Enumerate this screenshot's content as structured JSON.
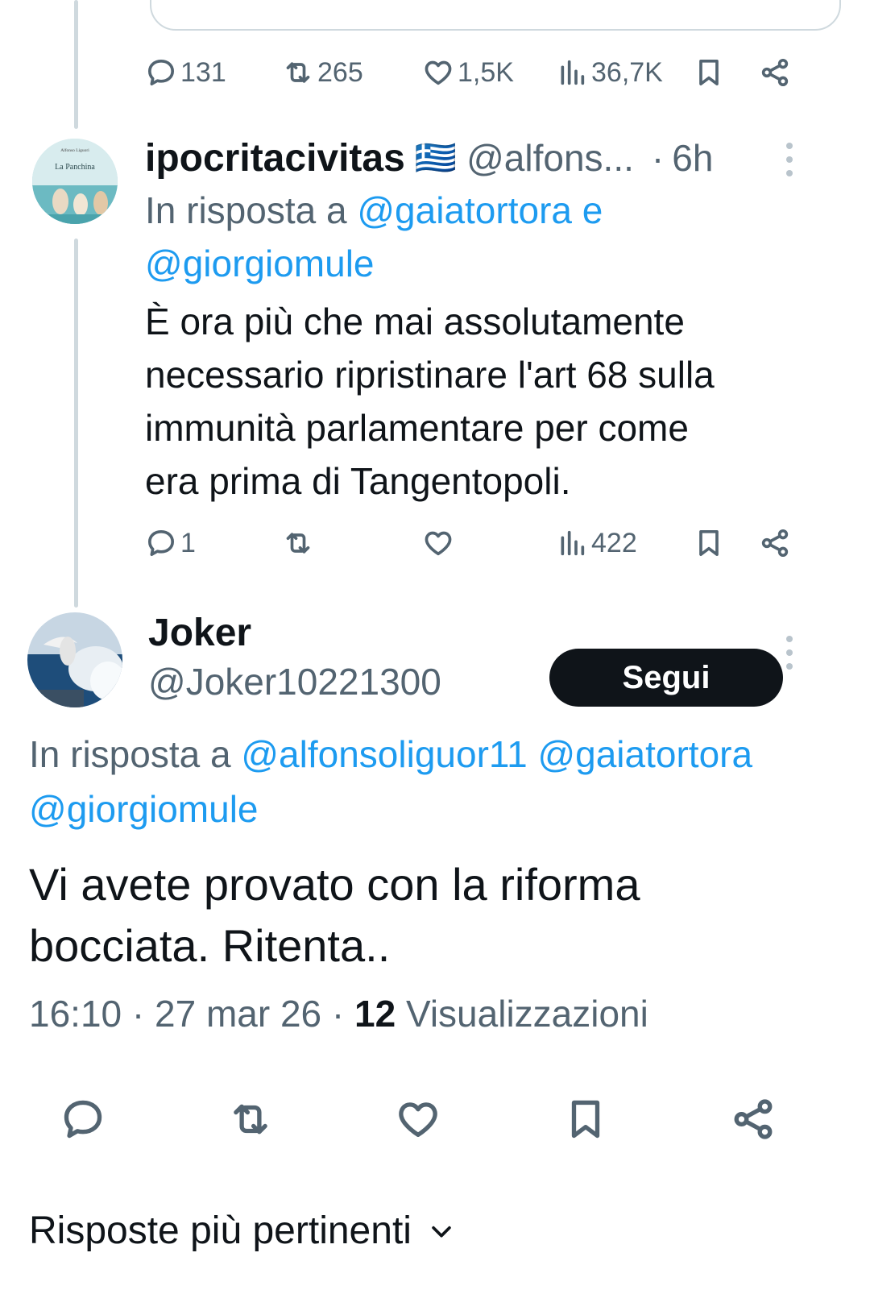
{
  "quoted_tweet_actions": {
    "replies": "131",
    "retweets": "265",
    "likes": "1,5K",
    "views": "36,7K"
  },
  "reply1": {
    "display_name": "ipocritacivitas",
    "flag": "🇬🇷",
    "handle": "@alfons...",
    "separator": "·",
    "time": "6h",
    "reply_prefix": "In risposta a",
    "reply_user1": "@gaiatortora",
    "reply_conj": "e",
    "reply_user2": "@giorgiomule",
    "text_lines": [
      "È ora più che mai assolutamente",
      "necessario ripristinare l'art 68 sulla",
      "immunità parlamentare per come",
      "era prima di Tangentopoli."
    ],
    "avatar_text": {
      "author": "Alfonso Liguori",
      "title": "La Panchina"
    },
    "actions": {
      "replies": "1",
      "retweets": "",
      "likes": "",
      "views": "422"
    }
  },
  "main_tweet": {
    "display_name": "Joker",
    "handle": "@Joker10221300",
    "follow_label": "Segui",
    "reply_prefix": "In risposta a",
    "reply_user1": "@alfonsoliguor11",
    "reply_user2": "@gaiatortora",
    "reply_user3": "@giorgiomule",
    "text_lines": [
      "Vi avete provato con la riforma",
      "bocciata. Ritenta.."
    ],
    "time": "16:10",
    "dot1": "·",
    "date": "27 mar 26",
    "dot2": "·",
    "views_count": "12",
    "views_label": "Visualizzazioni"
  },
  "replies_sort": {
    "label": "Risposte più pertinenti"
  },
  "colors": {
    "accent": "#1d9bf0",
    "text": "#0f1419",
    "muted": "#536471",
    "border": "#cfd9de"
  }
}
